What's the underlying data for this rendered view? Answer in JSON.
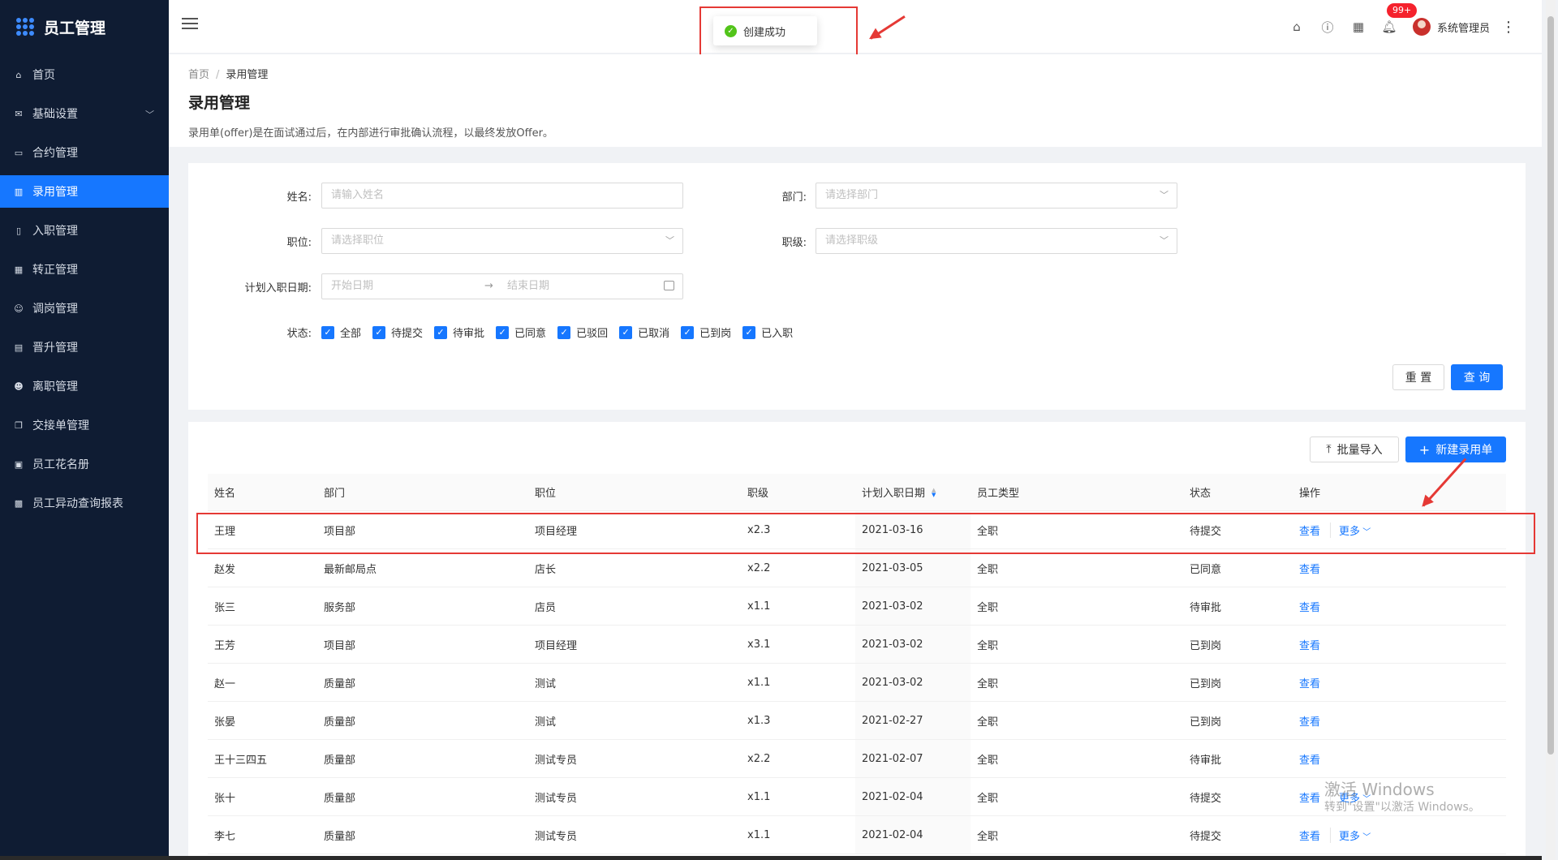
{
  "app": {
    "title": "员工管理"
  },
  "sidebar": {
    "items": [
      {
        "label": "首页",
        "icon": "home-icon"
      },
      {
        "label": "基础设置",
        "icon": "mail-icon",
        "expandable": true
      },
      {
        "label": "合约管理",
        "icon": "calendar-icon"
      },
      {
        "label": "录用管理",
        "icon": "layout-icon",
        "active": true
      },
      {
        "label": "入职管理",
        "icon": "book-icon"
      },
      {
        "label": "转正管理",
        "icon": "grid-icon"
      },
      {
        "label": "调岗管理",
        "icon": "user-icon"
      },
      {
        "label": "晋升管理",
        "icon": "file-icon"
      },
      {
        "label": "离职管理",
        "icon": "user-leave-icon"
      },
      {
        "label": "交接单管理",
        "icon": "copy-icon"
      },
      {
        "label": "员工花名册",
        "icon": "roster-icon"
      },
      {
        "label": "员工异动查询报表",
        "icon": "report-icon"
      }
    ]
  },
  "header": {
    "notification_badge": "99+",
    "username": "系统管理员"
  },
  "toast": {
    "message": "创建成功"
  },
  "page": {
    "breadcrumb": [
      "首页",
      "录用管理"
    ],
    "title": "录用管理",
    "description": "录用单(offer)是在面试通过后，在内部进行审批确认流程，以最终发放Offer。"
  },
  "filter": {
    "name_label": "姓名:",
    "name_placeholder": "请输入姓名",
    "dept_label": "部门:",
    "dept_placeholder": "请选择部门",
    "position_label": "职位:",
    "position_placeholder": "请选择职位",
    "level_label": "职级:",
    "level_placeholder": "请选择职级",
    "date_label": "计划入职日期:",
    "date_start_placeholder": "开始日期",
    "date_end_placeholder": "结束日期",
    "status_label": "状态:",
    "statuses": [
      "全部",
      "待提交",
      "待审批",
      "已同意",
      "已驳回",
      "已取消",
      "已到岗",
      "已入职"
    ],
    "reset_label": "重 置",
    "search_label": "查 询"
  },
  "toolbar": {
    "import_label": "批量导入",
    "new_label": "新建录用单"
  },
  "table": {
    "columns": [
      "姓名",
      "部门",
      "职位",
      "职级",
      "计划入职日期",
      "员工类型",
      "状态",
      "操作"
    ],
    "view_label": "查看",
    "more_label": "更多",
    "rows": [
      {
        "name": "王理",
        "dept": "项目部",
        "position": "项目经理",
        "level": "x2.3",
        "date": "2021-03-16",
        "type": "全职",
        "status": "待提交",
        "more": true
      },
      {
        "name": "赵发",
        "dept": "最新邮局点",
        "position": "店长",
        "level": "x2.2",
        "date": "2021-03-05",
        "type": "全职",
        "status": "已同意",
        "more": false
      },
      {
        "name": "张三",
        "dept": "服务部",
        "position": "店员",
        "level": "x1.1",
        "date": "2021-03-02",
        "type": "全职",
        "status": "待审批",
        "more": false
      },
      {
        "name": "王芳",
        "dept": "项目部",
        "position": "项目经理",
        "level": "x3.1",
        "date": "2021-03-02",
        "type": "全职",
        "status": "已到岗",
        "more": false
      },
      {
        "name": "赵一",
        "dept": "质量部",
        "position": "测试",
        "level": "x1.1",
        "date": "2021-03-02",
        "type": "全职",
        "status": "已到岗",
        "more": false
      },
      {
        "name": "张晏",
        "dept": "质量部",
        "position": "测试",
        "level": "x1.3",
        "date": "2021-02-27",
        "type": "全职",
        "status": "已到岗",
        "more": false
      },
      {
        "name": "王十三四五",
        "dept": "质量部",
        "position": "测试专员",
        "level": "x2.2",
        "date": "2021-02-07",
        "type": "全职",
        "status": "待审批",
        "more": false
      },
      {
        "name": "张十",
        "dept": "质量部",
        "position": "测试专员",
        "level": "x1.1",
        "date": "2021-02-04",
        "type": "全职",
        "status": "待提交",
        "more": true
      },
      {
        "name": "李七",
        "dept": "质量部",
        "position": "测试专员",
        "level": "x1.1",
        "date": "2021-02-04",
        "type": "全职",
        "status": "待提交",
        "more": true
      }
    ]
  },
  "watermark": {
    "line1": "激活 Windows",
    "line2": "转到\"设置\"以激活 Windows。"
  },
  "colors": {
    "sidebar_bg": "#0f1c33",
    "primary": "#1677ff",
    "annotation": "#e53935"
  }
}
